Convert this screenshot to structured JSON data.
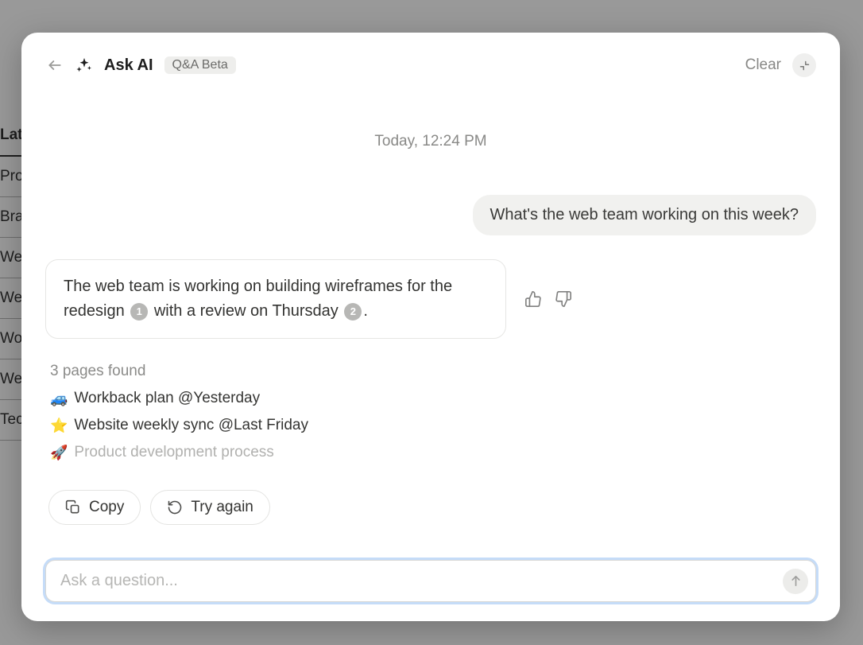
{
  "background_items": [
    "Lat",
    "Pro",
    "Bra",
    "We",
    "We",
    "Wo",
    "We",
    "Tec"
  ],
  "header": {
    "title": "Ask AI",
    "badge": "Q&A Beta",
    "clear_label": "Clear"
  },
  "timestamp": "Today, 12:24 PM",
  "user_message": "What's the web team working on this week?",
  "ai_message": {
    "part1": "The web team is working on building wireframes for the redesign",
    "cite1": "1",
    "part2": "with a review on Thursday",
    "cite2": "2",
    "part3": "."
  },
  "sources": {
    "count_label": "3 pages found",
    "items": [
      {
        "emoji": "🚙",
        "title": "Workback plan @Yesterday",
        "muted": false
      },
      {
        "emoji": "⭐",
        "title": "Website weekly sync @Last Friday",
        "muted": false
      },
      {
        "emoji": "🚀",
        "title": "Product development process",
        "muted": true
      }
    ]
  },
  "actions": {
    "copy": "Copy",
    "try_again": "Try again"
  },
  "input": {
    "placeholder": "Ask a question..."
  }
}
